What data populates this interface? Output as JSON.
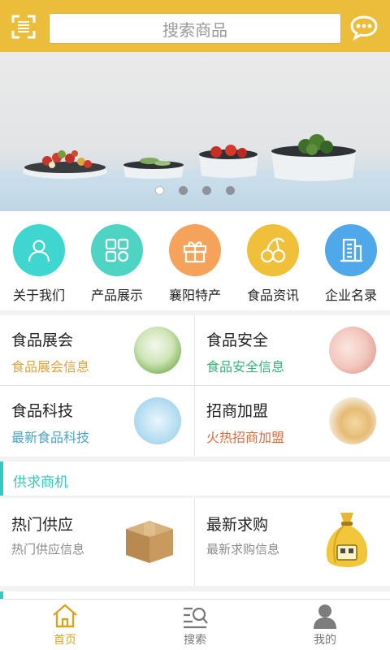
{
  "colors": {
    "header": "#ebbd3b",
    "teal": "#35c7c0",
    "orange_text": "#e0a23a",
    "green_text": "#35b37a",
    "blue_text": "#4aa3c8",
    "red_text": "#e46a3a"
  },
  "header": {
    "search_placeholder": "搜索商品",
    "scan_icon": "scan-icon",
    "chat_icon": "chat-icon"
  },
  "banner": {
    "slide_count": 4,
    "active_slide": 1
  },
  "categories": [
    {
      "label": "关于我们",
      "icon": "user-icon",
      "color": "#3fd6cf"
    },
    {
      "label": "产品展示",
      "icon": "grid-icon",
      "color": "#4fd4c4"
    },
    {
      "label": "襄阳特产",
      "icon": "gift-icon",
      "color": "#f5a35a"
    },
    {
      "label": "食品资讯",
      "icon": "cherry-icon",
      "color": "#f0c03a"
    },
    {
      "label": "企业名录",
      "icon": "building-icon",
      "color": "#4fa8ea"
    }
  ],
  "cards": [
    {
      "title": "食品展会",
      "sub": "食品展会信息",
      "sub_color": "#e0a23a"
    },
    {
      "title": "食品安全",
      "sub": "食品安全信息",
      "sub_color": "#35b37a"
    },
    {
      "title": "食品科技",
      "sub": "最新食品科技",
      "sub_color": "#4aa3c8"
    },
    {
      "title": "招商加盟",
      "sub": "火热招商加盟",
      "sub_color": "#e46a3a"
    }
  ],
  "section": {
    "title": "供求商机"
  },
  "supply": [
    {
      "title": "热门供应",
      "sub": "热门供应信息"
    },
    {
      "title": "最新求购",
      "sub": "最新求购信息"
    }
  ],
  "tabbar": [
    {
      "label": "首页",
      "icon": "home-icon",
      "active": true
    },
    {
      "label": "搜索",
      "icon": "search-icon",
      "active": false
    },
    {
      "label": "我的",
      "icon": "profile-icon",
      "active": false
    }
  ]
}
